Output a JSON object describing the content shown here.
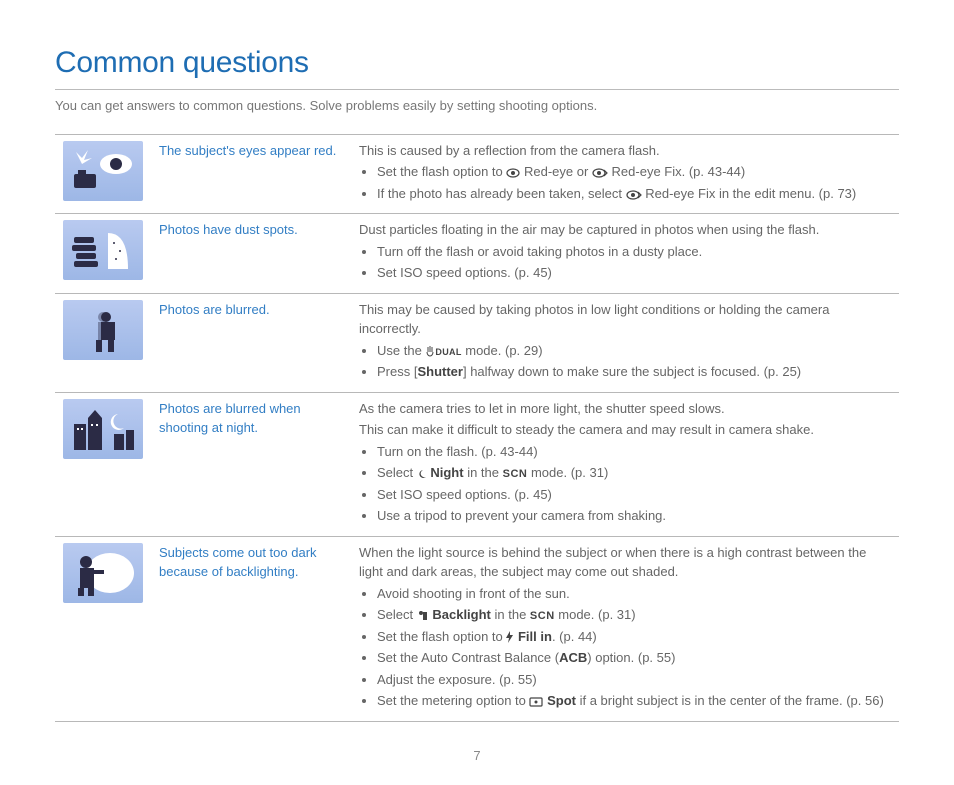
{
  "title": "Common questions",
  "subtitle": "You can get answers to common questions. Solve problems easily by setting shooting options.",
  "page_number": "7",
  "rows": [
    {
      "problem": "The subject's eyes appear red.",
      "intro": "This is caused by a reflection from the camera flash.",
      "b1a": "Set the flash option to ",
      "b1b": " Red-eye or ",
      "b1c": " Red-eye Fix. (p. 43-44)",
      "b2a": "If the photo has already been taken, select ",
      "b2b": " Red-eye Fix in the edit menu. (p. 73)"
    },
    {
      "problem": "Photos have dust spots.",
      "intro": "Dust particles floating in the air may be captured in photos when using the flash.",
      "b1": "Turn off the flash or avoid taking photos in a dusty place.",
      "b2": "Set ISO speed options. (p. 45)"
    },
    {
      "problem": "Photos are blurred.",
      "intro": "This may be caused by taking photos in low light conditions or holding the camera incorrectly.",
      "b1a": "Use the ",
      "b1b": " mode. (p. 29)",
      "b2a": "Press [",
      "b2b": "Shutter",
      "b2c": "] halfway down to make sure the subject is focused. (p. 25)"
    },
    {
      "problem": "Photos are blurred when shooting at night.",
      "intro1": "As the camera tries to let in more light, the shutter speed slows.",
      "intro2": "This can make it difficult to steady the camera and may result in camera shake.",
      "b1": "Turn on the flash. (p. 43-44)",
      "b2a": "Select ",
      "b2b": " Night",
      "b2c": " in the ",
      "b2d": " mode. (p. 31)",
      "b3": "Set ISO speed options. (p. 45)",
      "b4": "Use a tripod to prevent your camera from shaking."
    },
    {
      "problem": "Subjects come out too dark because of backlighting.",
      "intro": "When the light source is behind the subject or when there is a high contrast between the light and dark areas, the subject may come out shaded.",
      "b1": "Avoid shooting in front of the sun.",
      "b2a": "Select ",
      "b2b": " Backlight",
      "b2c": " in the ",
      "b2d": " mode. (p. 31)",
      "b3a": "Set the flash option to ",
      "b3b": " Fill in",
      "b3c": ". (p. 44)",
      "b4a": "Set the Auto Contrast Balance (",
      "b4b": "ACB",
      "b4c": ") option. (p. 55)",
      "b5": "Adjust the exposure. (p. 55)",
      "b6a": "Set the metering option to ",
      "b6b": " Spot",
      "b6c": " if a bright subject is in the center of the frame. (p. 56)"
    }
  ]
}
